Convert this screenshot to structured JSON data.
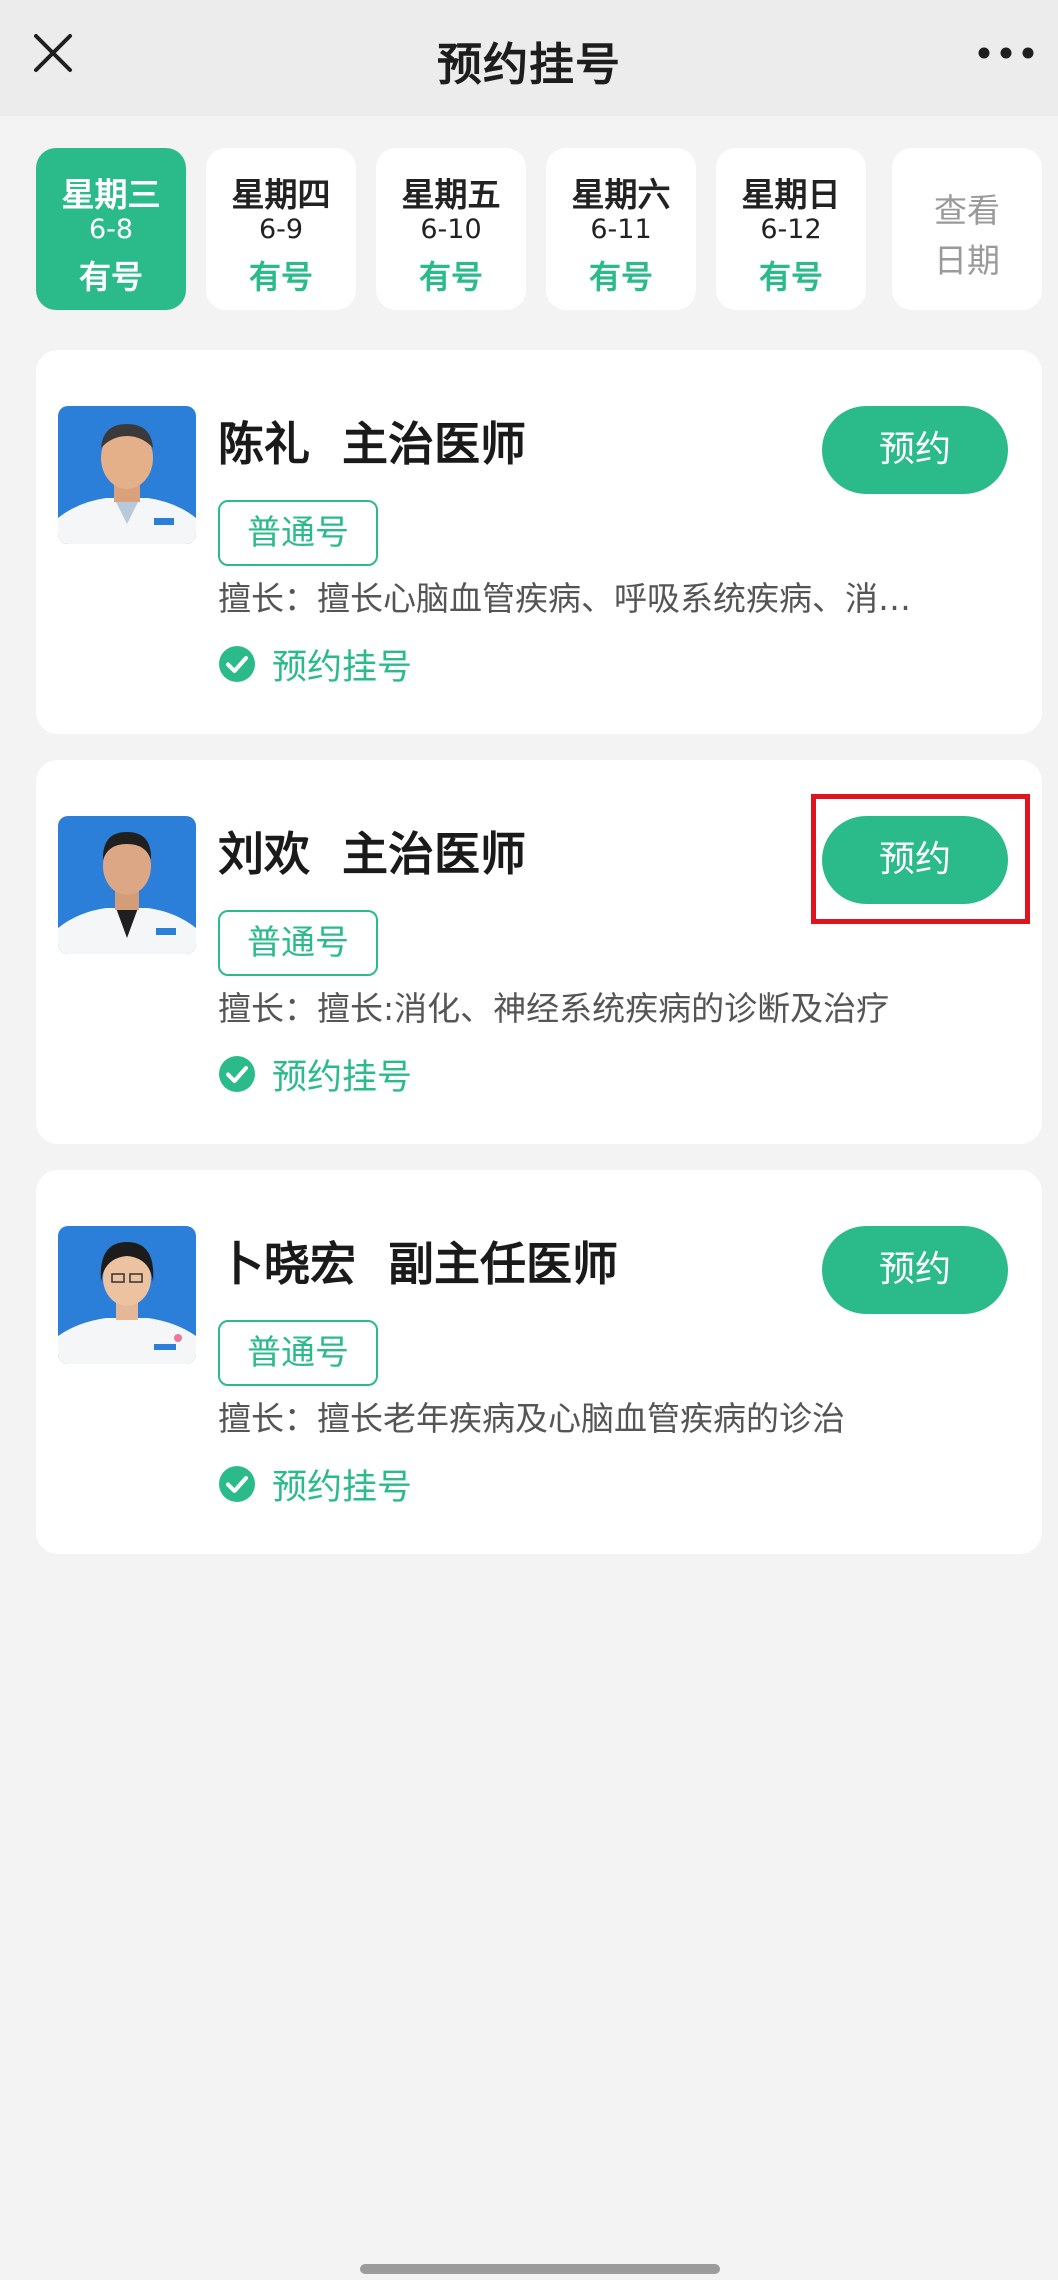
{
  "header": {
    "title": "预约挂号",
    "close_icon": "close-icon",
    "more_icon": "more-icon"
  },
  "date_tabs": [
    {
      "weekday": "星期三",
      "date": "6-8",
      "availability": "有号",
      "active": true
    },
    {
      "weekday": "星期四",
      "date": "6-9",
      "availability": "有号",
      "active": false
    },
    {
      "weekday": "星期五",
      "date": "6-10",
      "availability": "有号",
      "active": false
    },
    {
      "weekday": "星期六",
      "date": "6-11",
      "availability": "有号",
      "active": false
    },
    {
      "weekday": "星期日",
      "date": "6-12",
      "availability": "有号",
      "active": false
    }
  ],
  "view_dates": {
    "line1": "查看",
    "line2": "日期"
  },
  "doctors": [
    {
      "name": "陈礼  主治医师",
      "book_label": "预约",
      "tag": "普通号",
      "specialty": "擅长：擅长心脑血管疾病、呼吸系统疾病、消…",
      "status": "预约挂号"
    },
    {
      "name": "刘欢  主治医师",
      "book_label": "预约",
      "tag": "普通号",
      "specialty": "擅长：擅长:消化、神经系统疾病的诊断及治疗",
      "status": "预约挂号"
    },
    {
      "name": "卜晓宏  副主任医师",
      "book_label": "预约",
      "tag": "普通号",
      "specialty": "擅长：擅长老年疾病及心脑血管疾病的诊治",
      "status": "预约挂号"
    }
  ],
  "colors": {
    "accent": "#2bbb8b",
    "highlight": "#e0141e",
    "background": "#f3f3f3"
  }
}
